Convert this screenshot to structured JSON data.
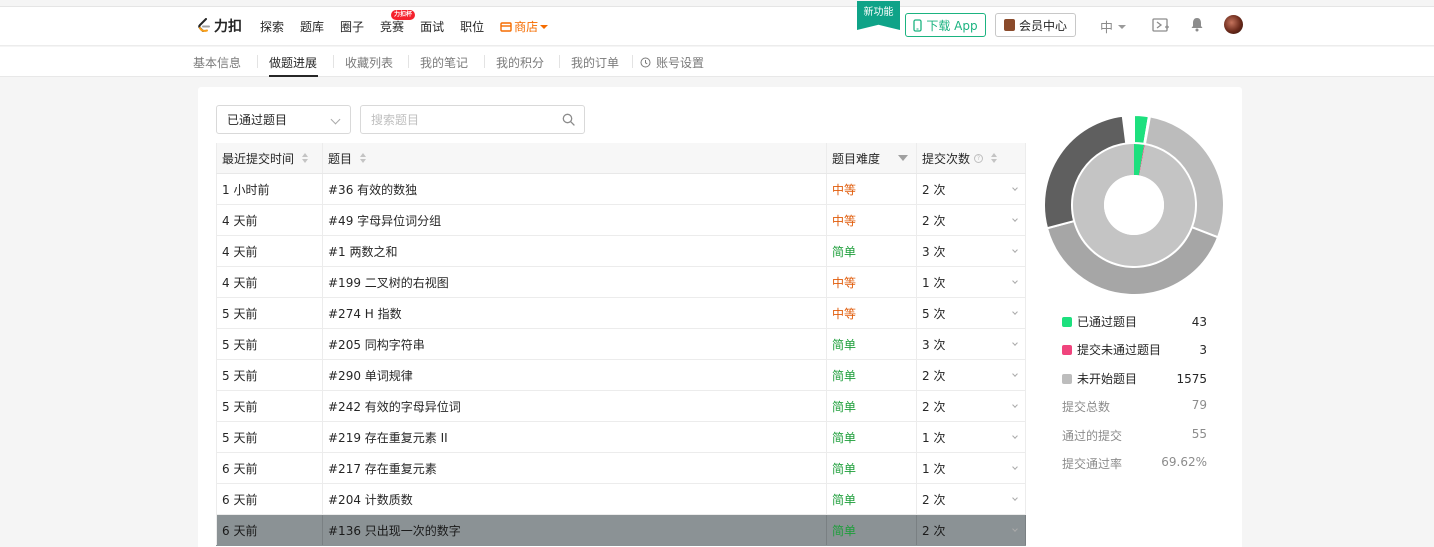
{
  "brand": {
    "name": "力扣"
  },
  "nav": {
    "items": [
      "探索",
      "题库",
      "圈子",
      "竞赛",
      "面试",
      "职位"
    ],
    "badge": "力扣杯",
    "store": "商店",
    "new_feature": "新功能",
    "download": "下载 App",
    "vip": "会员中心",
    "lang": "中"
  },
  "subnav": {
    "tabs": [
      "基本信息",
      "做题进展",
      "收藏列表",
      "我的笔记",
      "我的积分",
      "我的订单",
      "账号设置"
    ],
    "active": "做题进展"
  },
  "filter": {
    "selected": "已通过题目",
    "search_placeholder": "搜索题目"
  },
  "table": {
    "headers": [
      "最近提交时间",
      "题目",
      "题目难度",
      "提交次数"
    ],
    "rows": [
      {
        "time": "1 小时前",
        "title": "#36 有效的数独",
        "difficulty": "中等",
        "level": "medium",
        "count": "2 次"
      },
      {
        "time": "4 天前",
        "title": "#49 字母异位词分组",
        "difficulty": "中等",
        "level": "medium",
        "count": "2 次"
      },
      {
        "time": "4 天前",
        "title": "#1 两数之和",
        "difficulty": "简单",
        "level": "easy",
        "count": "3 次"
      },
      {
        "time": "4 天前",
        "title": "#199 二叉树的右视图",
        "difficulty": "中等",
        "level": "medium",
        "count": "1 次"
      },
      {
        "time": "5 天前",
        "title": "#274 H 指数",
        "difficulty": "中等",
        "level": "medium",
        "count": "5 次"
      },
      {
        "time": "5 天前",
        "title": "#205 同构字符串",
        "difficulty": "简单",
        "level": "easy",
        "count": "3 次"
      },
      {
        "time": "5 天前",
        "title": "#290 单词规律",
        "difficulty": "简单",
        "level": "easy",
        "count": "2 次"
      },
      {
        "time": "5 天前",
        "title": "#242 有效的字母异位词",
        "difficulty": "简单",
        "level": "easy",
        "count": "2 次"
      },
      {
        "time": "5 天前",
        "title": "#219 存在重复元素 II",
        "difficulty": "简单",
        "level": "easy",
        "count": "1 次"
      },
      {
        "time": "6 天前",
        "title": "#217 存在重复元素",
        "difficulty": "简单",
        "level": "easy",
        "count": "1 次"
      },
      {
        "time": "6 天前",
        "title": "#204 计数质数",
        "difficulty": "简单",
        "level": "easy",
        "count": "2 次"
      },
      {
        "time": "6 天前",
        "title": "#136 只出现一次的数字",
        "difficulty": "简单",
        "level": "easy",
        "count": "2 次"
      }
    ]
  },
  "stats": {
    "legend": [
      {
        "label": "已通过题目",
        "value": "43",
        "color": "#1de07e"
      },
      {
        "label": "提交未通过题目",
        "value": "3",
        "color": "#f0447d"
      },
      {
        "label": "未开始题目",
        "value": "1575",
        "color": "#bdbdbd"
      }
    ],
    "totals": [
      {
        "label": "提交总数",
        "value": "79"
      },
      {
        "label": "通过的提交",
        "value": "55"
      },
      {
        "label": "提交通过率",
        "value": "69.62%"
      }
    ]
  },
  "chart_data": {
    "type": "pie",
    "rings": [
      {
        "slices": [
          {
            "label": "已通过题目",
            "value": 43
          },
          {
            "label": "提交未通过题目",
            "value": 3
          },
          {
            "label": "未开始题目",
            "value": 1575
          }
        ]
      },
      {
        "slices": [
          {
            "label": "已通过题目",
            "value": 43
          },
          {
            "label": "提交未通过题目",
            "value": 3
          },
          {
            "label": "未开始题目",
            "value": 1575
          }
        ]
      }
    ],
    "colors": {
      "passed": "#1de07e",
      "failed": "#f0447d",
      "todo": "#bdbdbd"
    }
  }
}
